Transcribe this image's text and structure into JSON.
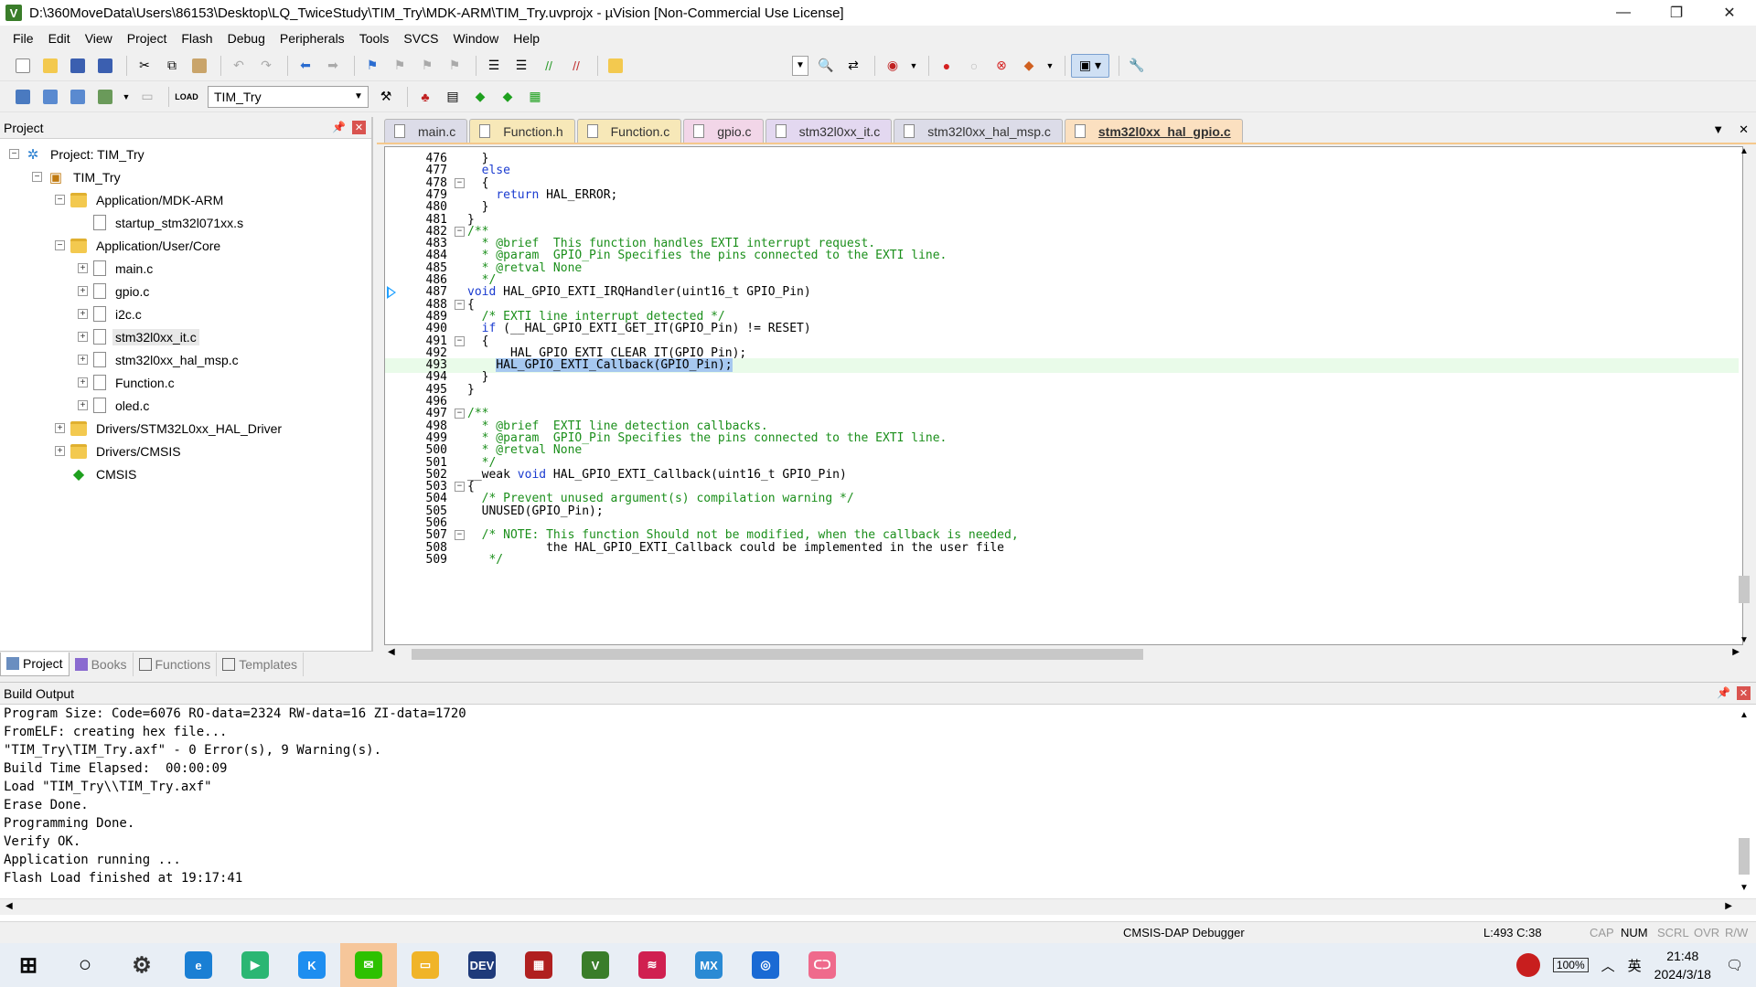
{
  "window": {
    "title": "D:\\360MoveData\\Users\\86153\\Desktop\\LQ_TwiceStudy\\TIM_Try\\MDK-ARM\\TIM_Try.uvprojx - µVision  [Non-Commercial Use License]",
    "app_icon_letter": "V"
  },
  "menu": [
    "File",
    "Edit",
    "View",
    "Project",
    "Flash",
    "Debug",
    "Peripherals",
    "Tools",
    "SVCS",
    "Window",
    "Help"
  ],
  "toolbar2": {
    "target": "TIM_Try"
  },
  "project_panel": {
    "title": "Project",
    "tree": [
      {
        "label": "Project: TIM_Try",
        "level": 0,
        "toggle": "−",
        "icon": "project"
      },
      {
        "label": "TIM_Try",
        "level": 1,
        "toggle": "−",
        "icon": "target"
      },
      {
        "label": "Application/MDK-ARM",
        "level": 2,
        "toggle": "−",
        "icon": "folder"
      },
      {
        "label": "startup_stm32l071xx.s",
        "level": 3,
        "toggle": "",
        "icon": "file"
      },
      {
        "label": "Application/User/Core",
        "level": 2,
        "toggle": "−",
        "icon": "folder"
      },
      {
        "label": "main.c",
        "level": 3,
        "toggle": "+",
        "icon": "file"
      },
      {
        "label": "gpio.c",
        "level": 3,
        "toggle": "+",
        "icon": "file"
      },
      {
        "label": "i2c.c",
        "level": 3,
        "toggle": "+",
        "icon": "file"
      },
      {
        "label": "stm32l0xx_it.c",
        "level": 3,
        "toggle": "+",
        "icon": "file",
        "selected": true
      },
      {
        "label": "stm32l0xx_hal_msp.c",
        "level": 3,
        "toggle": "+",
        "icon": "file"
      },
      {
        "label": "Function.c",
        "level": 3,
        "toggle": "+",
        "icon": "file"
      },
      {
        "label": "oled.c",
        "level": 3,
        "toggle": "+",
        "icon": "file"
      },
      {
        "label": "Drivers/STM32L0xx_HAL_Driver",
        "level": 2,
        "toggle": "+",
        "icon": "folder"
      },
      {
        "label": "Drivers/CMSIS",
        "level": 2,
        "toggle": "+",
        "icon": "folder"
      },
      {
        "label": "CMSIS",
        "level": 2,
        "toggle": "",
        "icon": "cmsis"
      }
    ],
    "tabs": [
      "Project",
      "Books",
      "Functions",
      "Templates"
    ]
  },
  "editor": {
    "tabs": [
      {
        "label": "main.c",
        "color": "#dcdce8"
      },
      {
        "label": "Function.h",
        "color": "#f7e8b8"
      },
      {
        "label": "Function.c",
        "color": "#f7e8b8"
      },
      {
        "label": "gpio.c",
        "color": "#f2d6e8"
      },
      {
        "label": "stm32l0xx_it.c",
        "color": "#e3d8f0"
      },
      {
        "label": "stm32l0xx_hal_msp.c",
        "color": "#dcdce8"
      },
      {
        "label": "stm32l0xx_hal_gpio.c",
        "color": "#fbe0c0",
        "active": true
      }
    ],
    "lines": [
      {
        "n": "476",
        "fold": "",
        "text": "  }"
      },
      {
        "n": "477",
        "fold": "",
        "text": "  else"
      },
      {
        "n": "478",
        "fold": "−",
        "text": "  {"
      },
      {
        "n": "479",
        "fold": "",
        "text": "    return HAL_ERROR;"
      },
      {
        "n": "480",
        "fold": "",
        "text": "  }"
      },
      {
        "n": "481",
        "fold": "",
        "text": "}"
      },
      {
        "n": "482",
        "fold": "−",
        "text": "/**"
      },
      {
        "n": "483",
        "fold": "",
        "text": "  * @brief  This function handles EXTI interrupt request."
      },
      {
        "n": "484",
        "fold": "",
        "text": "  * @param  GPIO_Pin Specifies the pins connected to the EXTI line."
      },
      {
        "n": "485",
        "fold": "",
        "text": "  * @retval None"
      },
      {
        "n": "486",
        "fold": "",
        "text": "  */"
      },
      {
        "n": "487",
        "fold": "",
        "text": "void HAL_GPIO_EXTI_IRQHandler(uint16_t GPIO_Pin)"
      },
      {
        "n": "488",
        "fold": "−",
        "text": "{"
      },
      {
        "n": "489",
        "fold": "",
        "text": "  /* EXTI line interrupt detected */"
      },
      {
        "n": "490",
        "fold": "",
        "text": "  if (__HAL_GPIO_EXTI_GET_IT(GPIO_Pin) != RESET)"
      },
      {
        "n": "491",
        "fold": "−",
        "text": "  {"
      },
      {
        "n": "492",
        "fold": "",
        "text": "    __HAL_GPIO_EXTI_CLEAR_IT(GPIO_Pin);"
      },
      {
        "n": "493",
        "fold": "",
        "text": "    HAL_GPIO_EXTI_Callback(GPIO_Pin);"
      },
      {
        "n": "494",
        "fold": "",
        "text": "  }"
      },
      {
        "n": "495",
        "fold": "",
        "text": "}"
      },
      {
        "n": "496",
        "fold": "",
        "text": ""
      },
      {
        "n": "497",
        "fold": "−",
        "text": "/**"
      },
      {
        "n": "498",
        "fold": "",
        "text": "  * @brief  EXTI line detection callbacks."
      },
      {
        "n": "499",
        "fold": "",
        "text": "  * @param  GPIO_Pin Specifies the pins connected to the EXTI line."
      },
      {
        "n": "500",
        "fold": "",
        "text": "  * @retval None"
      },
      {
        "n": "501",
        "fold": "",
        "text": "  */"
      },
      {
        "n": "502",
        "fold": "",
        "text": "__weak void HAL_GPIO_EXTI_Callback(uint16_t GPIO_Pin)"
      },
      {
        "n": "503",
        "fold": "−",
        "text": "{"
      },
      {
        "n": "504",
        "fold": "",
        "text": "  /* Prevent unused argument(s) compilation warning */"
      },
      {
        "n": "505",
        "fold": "",
        "text": "  UNUSED(GPIO_Pin);"
      },
      {
        "n": "506",
        "fold": "",
        "text": ""
      },
      {
        "n": "507",
        "fold": "−",
        "text": "  /* NOTE: This function Should not be modified, when the callback is needed,"
      },
      {
        "n": "508",
        "fold": "",
        "text": "           the HAL_GPIO_EXTI_Callback could be implemented in the user file"
      },
      {
        "n": "509",
        "fold": "",
        "text": "   */"
      }
    ],
    "current_line": "493",
    "exec_line": "487"
  },
  "build_output": {
    "title": "Build Output",
    "lines": [
      "Program Size: Code=6076 RO-data=2324 RW-data=16 ZI-data=1720",
      "FromELF: creating hex file...",
      "\"TIM_Try\\TIM_Try.axf\" - 0 Error(s), 9 Warning(s).",
      "Build Time Elapsed:  00:00:09",
      "Load \"TIM_Try\\\\TIM_Try.axf\"",
      "Erase Done.",
      "Programming Done.",
      "Verify OK.",
      "Application running ...",
      "Flash Load finished at 19:17:41"
    ]
  },
  "status_bar": {
    "debugger": "CMSIS-DAP Debugger",
    "position": "L:493 C:38",
    "cap": "CAP",
    "num": "NUM",
    "scrl": "SCRL",
    "ovr": "OVR",
    "rw": "R/W"
  },
  "taskbar": {
    "apps": [
      {
        "name": "start",
        "color": "#0a0a0a",
        "glyph": "⊞"
      },
      {
        "name": "search",
        "color": "#0a0a0a",
        "glyph": "○"
      },
      {
        "name": "settings",
        "color": "#333",
        "glyph": "⚙"
      },
      {
        "name": "edge",
        "color": "#1a7fd4",
        "glyph": "e"
      },
      {
        "name": "green-app",
        "color": "#2bb673",
        "glyph": "▶"
      },
      {
        "name": "k-app",
        "color": "#1e8ef0",
        "glyph": "K"
      },
      {
        "name": "wechat",
        "color": "#2dc100",
        "glyph": "✉",
        "active": true
      },
      {
        "name": "explorer",
        "color": "#f0b428",
        "glyph": "▭"
      },
      {
        "name": "devcpp",
        "color": "#1e3a7a",
        "glyph": "DEV"
      },
      {
        "name": "app-grid",
        "color": "#b02020",
        "glyph": "▦"
      },
      {
        "name": "keil",
        "color": "#3a7d2a",
        "glyph": "V"
      },
      {
        "name": "wave-app",
        "color": "#d02050",
        "glyph": "≋"
      },
      {
        "name": "stm32cubemx",
        "color": "#2a8ad4",
        "glyph": "MX"
      },
      {
        "name": "blue-app",
        "color": "#1a6ad4",
        "glyph": "◎"
      },
      {
        "name": "bilibili",
        "color": "#ef6a8c",
        "glyph": "ᑕᑐ"
      }
    ],
    "battery": "100%",
    "ime": "英",
    "time": "21:48",
    "date": "2024/3/18"
  }
}
